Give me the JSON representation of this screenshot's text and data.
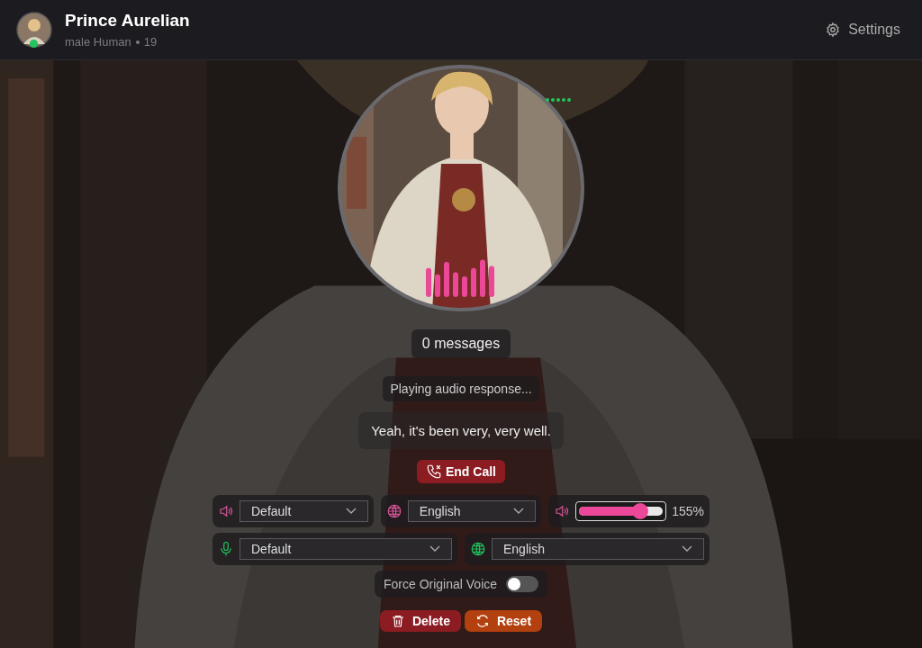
{
  "header": {
    "name": "Prince Aurelian",
    "subtitle": "male Human",
    "age": "19",
    "online": true,
    "settings": "Settings"
  },
  "call": {
    "messages": "0 messages",
    "status": "Playing audio response...",
    "transcript": "Yeah, it's been very, very well.",
    "end_call": "End Call",
    "speaking": true
  },
  "output": {
    "device": "Default",
    "language": "English",
    "volume": {
      "level": 0.73,
      "reading": "155%"
    }
  },
  "input": {
    "device": "Default",
    "language": "English"
  },
  "force_original_voice": {
    "label": "Force Original Voice",
    "on": false
  },
  "actions": [
    {
      "kind": "delete",
      "label": "Delete"
    },
    {
      "kind": "reset",
      "label": "Reset"
    }
  ]
}
